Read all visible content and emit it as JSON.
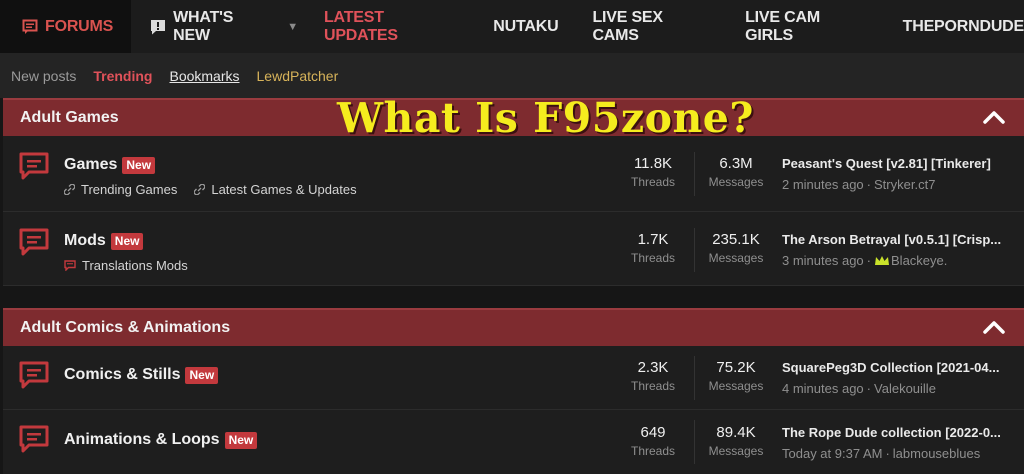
{
  "nav": {
    "forums": "FORUMS",
    "whats_new": "WHAT'S NEW",
    "latest_updates": "LATEST UPDATES",
    "nutaku": "NUTAKU",
    "live_sex_cams": "LIVE SEX CAMS",
    "live_cam_girls": "LIVE CAM GIRLS",
    "theporndude": "THEPORNDUDE"
  },
  "subnav": {
    "new_posts": "New posts",
    "trending": "Trending",
    "bookmarks": "Bookmarks",
    "lewdpatcher": "LewdPatcher"
  },
  "overlay_title": "What Is F95zone?",
  "categories": [
    {
      "title": "Adult Games",
      "forums": [
        {
          "name": "Games",
          "badge": "New",
          "subforums": [
            "Trending Games",
            "Latest Games & Updates"
          ],
          "threads": "11.8K",
          "threads_label": "Threads",
          "messages": "6.3M",
          "messages_label": "Messages",
          "latest_title": "Peasant's Quest [v2.81] [Tinkerer]",
          "latest_time": "2 minutes ago",
          "latest_user": "Stryker.ct7"
        },
        {
          "name": "Mods",
          "badge": "New",
          "subforums": [
            "Translations Mods"
          ],
          "threads": "1.7K",
          "threads_label": "Threads",
          "messages": "235.1K",
          "messages_label": "Messages",
          "latest_title": "The Arson Betrayal [v0.5.1] [Crisp...",
          "latest_time": "3 minutes ago",
          "latest_user": "Blackeye."
        }
      ]
    },
    {
      "title": "Adult Comics & Animations",
      "forums": [
        {
          "name": "Comics & Stills",
          "badge": "New",
          "threads": "2.3K",
          "threads_label": "Threads",
          "messages": "75.2K",
          "messages_label": "Messages",
          "latest_title": "SquarePeg3D Collection [2021-04...",
          "latest_time": "4 minutes ago",
          "latest_user": "Valekouille"
        },
        {
          "name": "Animations & Loops",
          "badge": "New",
          "threads": "649",
          "threads_label": "Threads",
          "messages": "89.4K",
          "messages_label": "Messages",
          "latest_title": "The Rope Dude collection [2022-0...",
          "latest_time": "Today at 9:37 AM",
          "latest_user": "labmouseblues"
        }
      ]
    }
  ],
  "colors": {
    "accent": "#e0525a",
    "category_bar": "#7e2b2f",
    "overlay": "#f5ec1e",
    "crown": "#c9e22a"
  }
}
